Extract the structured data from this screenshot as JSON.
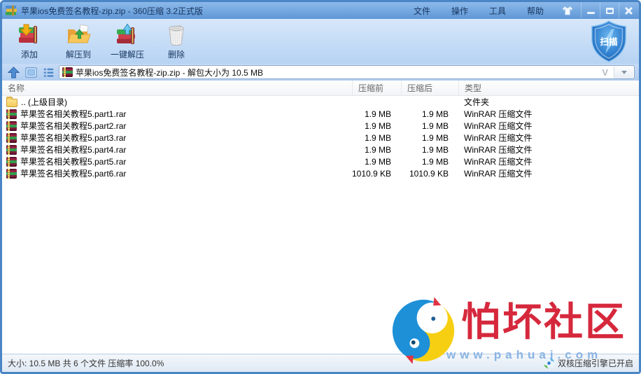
{
  "window": {
    "title": "苹果ios免费签名教程-zip.zip - 360压缩 3.2正式版",
    "menu": [
      {
        "label": "文件"
      },
      {
        "label": "操作"
      },
      {
        "label": "工具"
      },
      {
        "label": "帮助"
      }
    ]
  },
  "toolbar": {
    "add": "添加",
    "extract_to": "解压到",
    "one_key": "一键解压",
    "delete": "删除",
    "scan": "扫描"
  },
  "addressbar": {
    "value": "苹果ios免费签名教程-zip.zip - 解包大小为 10.5 MB"
  },
  "icons": {
    "chevron_v": "V"
  },
  "table": {
    "headers": {
      "name": "名称",
      "before": "压缩前",
      "after": "压缩后",
      "type": "类型"
    },
    "parent": {
      "name": ".. (上级目录)",
      "type": "文件夹"
    },
    "rows": [
      {
        "name": "苹果签名相关教程5.part1.rar",
        "before": "1.9 MB",
        "after": "1.9 MB",
        "type": "WinRAR 压缩文件"
      },
      {
        "name": "苹果签名相关教程5.part2.rar",
        "before": "1.9 MB",
        "after": "1.9 MB",
        "type": "WinRAR 压缩文件"
      },
      {
        "name": "苹果签名相关教程5.part3.rar",
        "before": "1.9 MB",
        "after": "1.9 MB",
        "type": "WinRAR 压缩文件"
      },
      {
        "name": "苹果签名相关教程5.part4.rar",
        "before": "1.9 MB",
        "after": "1.9 MB",
        "type": "WinRAR 压缩文件"
      },
      {
        "name": "苹果签名相关教程5.part5.rar",
        "before": "1.9 MB",
        "after": "1.9 MB",
        "type": "WinRAR 压缩文件"
      },
      {
        "name": "苹果签名相关教程5.part6.rar",
        "before": "1010.9 KB",
        "after": "1010.9 KB",
        "type": "WinRAR 压缩文件"
      }
    ]
  },
  "watermark": {
    "title": "怕坏社区",
    "url": "www.pahuai.com"
  },
  "statusbar": {
    "left": "大小: 10.5 MB 共 6 个文件 压缩率 100.0%",
    "engine": "双核压缩引擎已开启"
  },
  "colors": {
    "titlebar_blue": "#5e97d6",
    "toolbar_blue": "#c6dbf6",
    "watermark_red": "#d6283c",
    "shield_blue": "#2f7fd0"
  }
}
